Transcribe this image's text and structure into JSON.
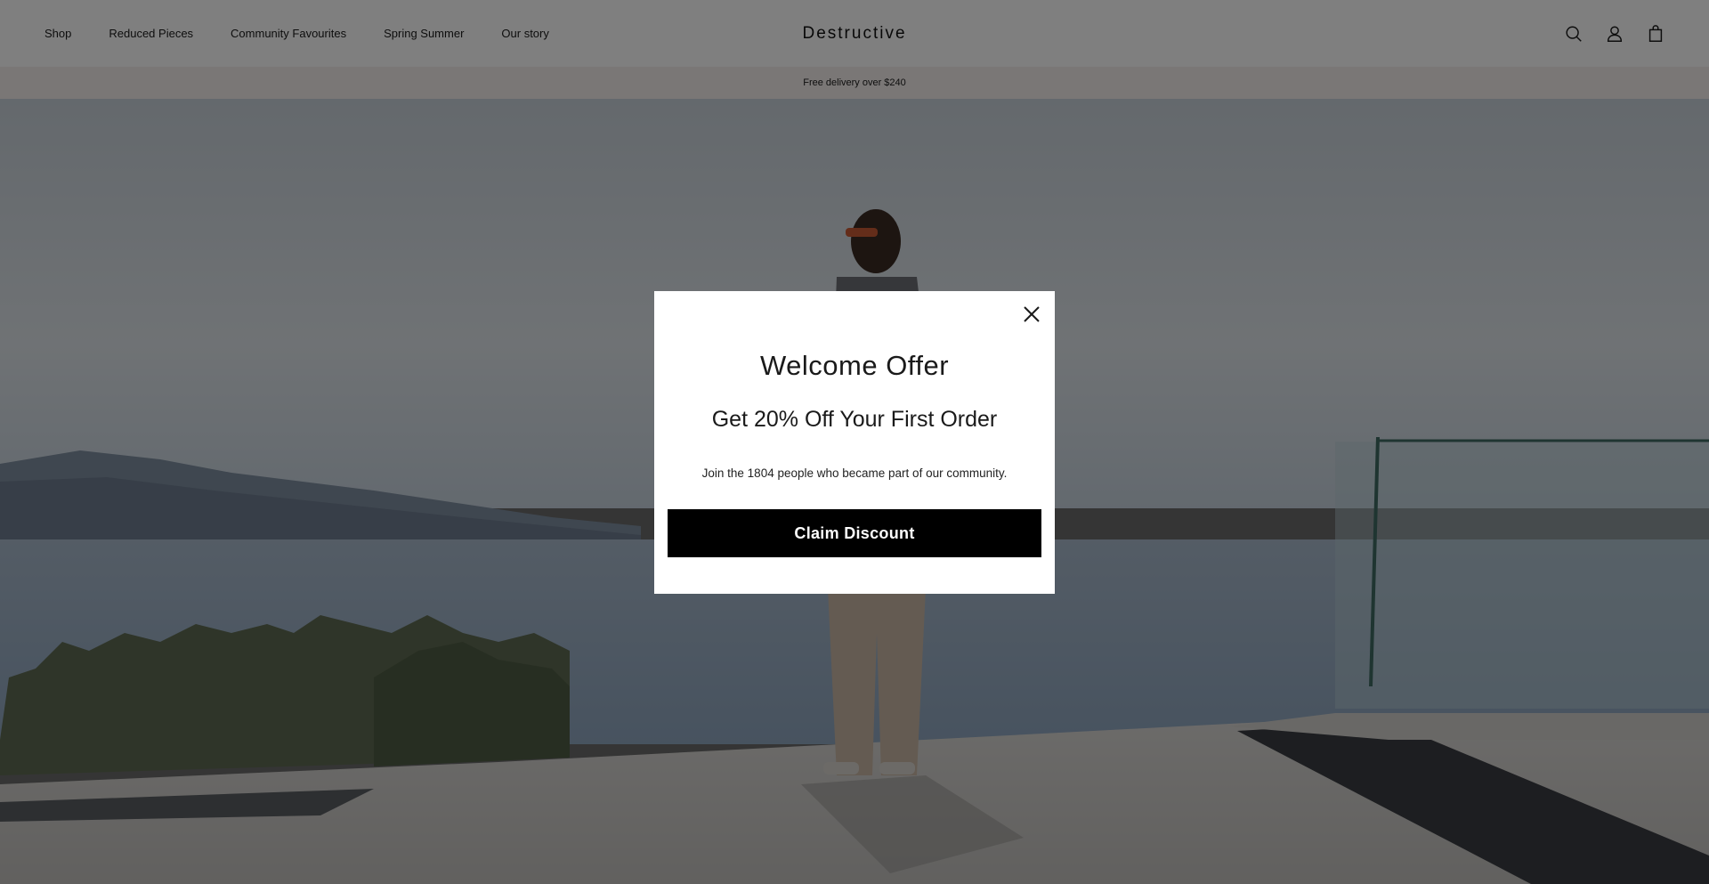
{
  "header": {
    "nav": [
      {
        "label": "Shop"
      },
      {
        "label": "Reduced Pieces"
      },
      {
        "label": "Community Favourites"
      },
      {
        "label": "Spring Summer"
      },
      {
        "label": "Our story"
      }
    ],
    "logo": "Destructive",
    "icons": [
      "search-icon",
      "account-icon",
      "bag-icon"
    ]
  },
  "announcement": {
    "text": "Free delivery over $240"
  },
  "modal": {
    "title": "Welcome Offer",
    "subtitle": "Get 20% Off Your First Order",
    "text": "Join the 1804 people who became part of our community.",
    "button_label": "Claim Discount",
    "close_icon": "close-icon"
  },
  "colors": {
    "header_bg": "#ffffff",
    "announcement_bg": "#f4efed",
    "overlay": "rgba(0,0,0,0.5)",
    "button_bg": "#000000",
    "button_text": "#ffffff"
  }
}
